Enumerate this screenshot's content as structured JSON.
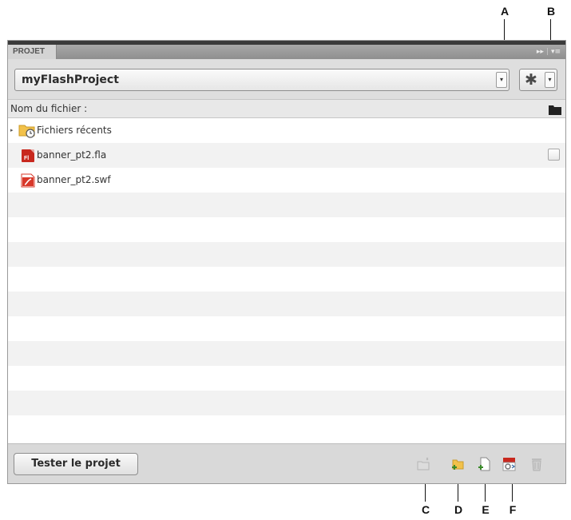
{
  "callouts": {
    "a": "A",
    "b": "B",
    "c": "C",
    "d": "D",
    "e": "E",
    "f": "F"
  },
  "panel": {
    "tab_label": "PROJET",
    "controls": {
      "collapse": "▸▸",
      "separator": "|",
      "menu": "▾≡"
    },
    "project_select": {
      "value": "myFlashProject",
      "arrow": "▾"
    },
    "settings": {
      "gear": "✱",
      "arrow": "▾"
    }
  },
  "list": {
    "header": "Nom du fichier :",
    "items": [
      {
        "label": "Fichiers récents",
        "icon": "folder-clock-icon",
        "expand": "▸"
      },
      {
        "label": "banner_pt2.fla",
        "icon": "fla-file-icon"
      },
      {
        "label": "banner_pt2.swf",
        "icon": "swf-file-icon"
      }
    ]
  },
  "footer": {
    "test_label": "Tester le projet",
    "tool_icons": [
      "new-folder-disabled-icon",
      "new-folder-icon",
      "new-file-icon",
      "publish-settings-icon",
      "trash-icon"
    ]
  },
  "colors": {
    "fla_red": "#c8281e",
    "swf_red": "#d8382a",
    "folder_yellow": "#f2c14a",
    "panel_gray": "#d9d9d9",
    "row_alt": "#f2f2f2"
  }
}
